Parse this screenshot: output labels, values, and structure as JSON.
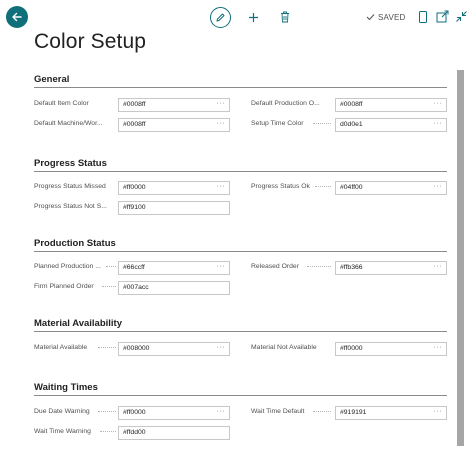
{
  "header": {
    "saved_label": "SAVED"
  },
  "page": {
    "title": "Color Setup"
  },
  "sections": {
    "general": {
      "title": "General",
      "default_item_color": {
        "label": "Default Item Color",
        "value": "#0008ff"
      },
      "default_production_order": {
        "label": "Default Production O...",
        "value": "#0008ff"
      },
      "default_machine_work": {
        "label": "Default Machine/Wor...",
        "value": "#0008ff"
      },
      "setup_time_color": {
        "label": "Setup Time Color",
        "value": "d0d0e1"
      }
    },
    "progress_status": {
      "title": "Progress Status",
      "progress_status_missed": {
        "label": "Progress Status Missed",
        "value": "#ff0000"
      },
      "progress_status_ok": {
        "label": "Progress Status Ok",
        "value": "#04ff00"
      },
      "progress_status_not_s": {
        "label": "Progress Status Not S...",
        "value": "#ff9100"
      }
    },
    "production_status": {
      "title": "Production Status",
      "planned_production": {
        "label": "Planned Production ...",
        "value": "#66ccff"
      },
      "released_order": {
        "label": "Released Order",
        "value": "#ffb366"
      },
      "firm_planned_order": {
        "label": "Firm Planned Order",
        "value": "#007acc"
      }
    },
    "material_availability": {
      "title": "Material Availability",
      "material_available": {
        "label": "Material Available",
        "value": "#008000"
      },
      "material_not_available": {
        "label": "Material Not Available",
        "value": "#ff0000"
      }
    },
    "waiting_times": {
      "title": "Waiting Times",
      "due_date_warning": {
        "label": "Due Date Warning",
        "value": "#ff0000"
      },
      "wait_time_default": {
        "label": "Wait Time Default",
        "value": "#919191"
      },
      "wait_time_warning": {
        "label": "Wait Time Warning",
        "value": "#ffdd00"
      }
    }
  },
  "common": {
    "ellipsis": "···"
  },
  "colors": {
    "accent": "#0f6f7a",
    "scrollbar": "#a6a6a6"
  },
  "icons": {
    "back": "back-arrow-icon",
    "edit": "pencil-icon",
    "add": "plus-icon",
    "delete": "trash-icon",
    "saved": "checkmark-icon",
    "share": "share-icon",
    "expand": "expand-icon",
    "collapse": "collapse-icon"
  }
}
